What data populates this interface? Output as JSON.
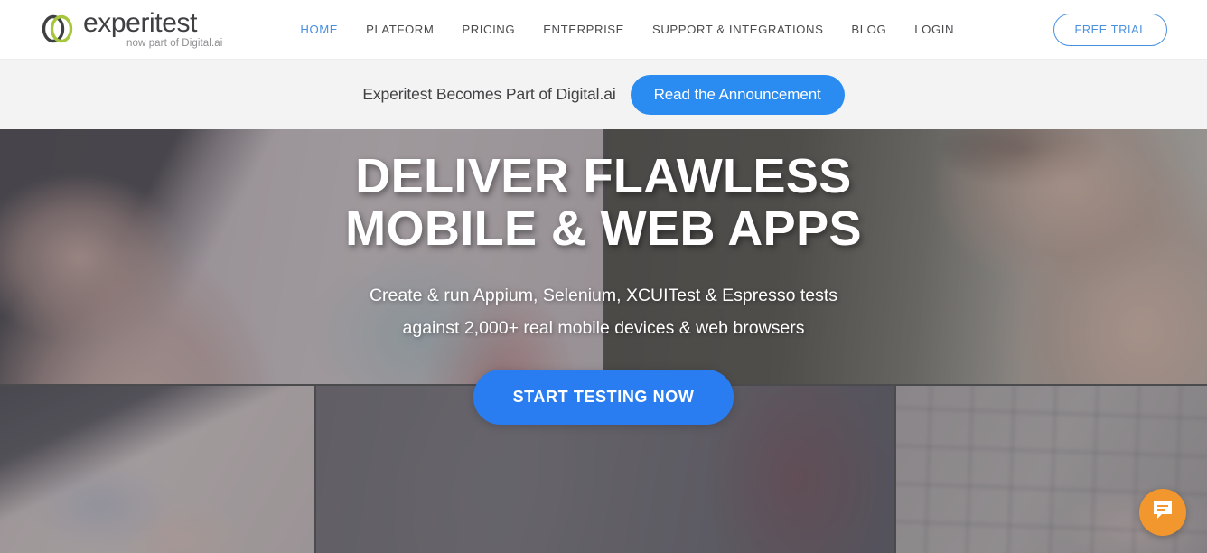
{
  "header": {
    "logo": {
      "name": "experitest",
      "tagline": "now part of Digital.ai",
      "mark_icon": "two-overlapping-rings-icon"
    },
    "nav": [
      {
        "label": "HOME",
        "active": true
      },
      {
        "label": "PLATFORM",
        "active": false
      },
      {
        "label": "PRICING",
        "active": false
      },
      {
        "label": "ENTERPRISE",
        "active": false
      },
      {
        "label": "SUPPORT & INTEGRATIONS",
        "active": false
      },
      {
        "label": "BLOG",
        "active": false
      },
      {
        "label": "LOGIN",
        "active": false
      }
    ],
    "free_trial_label": "FREE TRIAL"
  },
  "banner": {
    "text": "Experitest Becomes Part of Digital.ai",
    "button_label": "Read the Announcement"
  },
  "hero": {
    "title_line1": "DELIVER FLAWLESS",
    "title_line2": "MOBILE & WEB APPS",
    "subtitle_line1": "Create & run Appium, Selenium, XCUITest & Espresso tests",
    "subtitle_line2": "against 2,000+ real mobile devices & web browsers",
    "cta_label": "START TESTING NOW",
    "panels": [
      {
        "id": "top-left",
        "description": "hand holding smartphone, blurred"
      },
      {
        "id": "top-right",
        "description": "hands holding smartphone, dark blurred"
      },
      {
        "id": "bottom-left",
        "description": "smartphone showing map application"
      },
      {
        "id": "bottom-center",
        "description": "dark blurred background"
      },
      {
        "id": "bottom-right",
        "description": "cobblestone pavement with smartphone"
      }
    ]
  },
  "chat": {
    "icon": "chat-bubble-icon",
    "color": "#f2962e"
  },
  "colors": {
    "accent_blue": "#4a90e2",
    "button_blue": "#2a8cf0",
    "cta_blue": "#2a7df0",
    "banner_bg": "#f3f3f3",
    "logo_green": "#a6c73c",
    "logo_dark": "#3f4041",
    "chat_orange": "#f2962e"
  }
}
